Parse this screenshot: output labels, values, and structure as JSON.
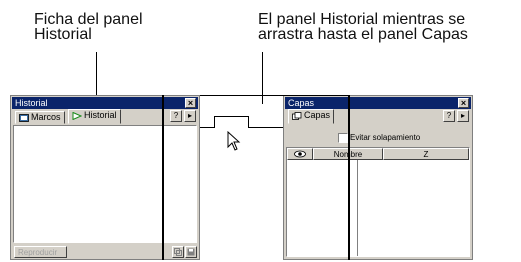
{
  "callouts": {
    "left": "Ficha del panel\nHistorial",
    "right": "El panel Historial mientras se\narrastra hasta el panel Capas"
  },
  "historial_panel": {
    "title": "Historial",
    "close_glyph": "×",
    "tabs": [
      "Marcos",
      "Historial"
    ],
    "help_glyph": "?",
    "menu_glyph": "▸",
    "replay_button": "Reproducir"
  },
  "capas_panel": {
    "title": "Capas",
    "close_glyph": "×",
    "tab": "Capas",
    "help_glyph": "?",
    "menu_glyph": "▸",
    "overlap_label": "Evitar solapamiento",
    "columns": [
      "Nombre",
      "Z"
    ]
  },
  "colors": {
    "title_active": "#0a246a",
    "panel_face": "#d4d0c8"
  }
}
